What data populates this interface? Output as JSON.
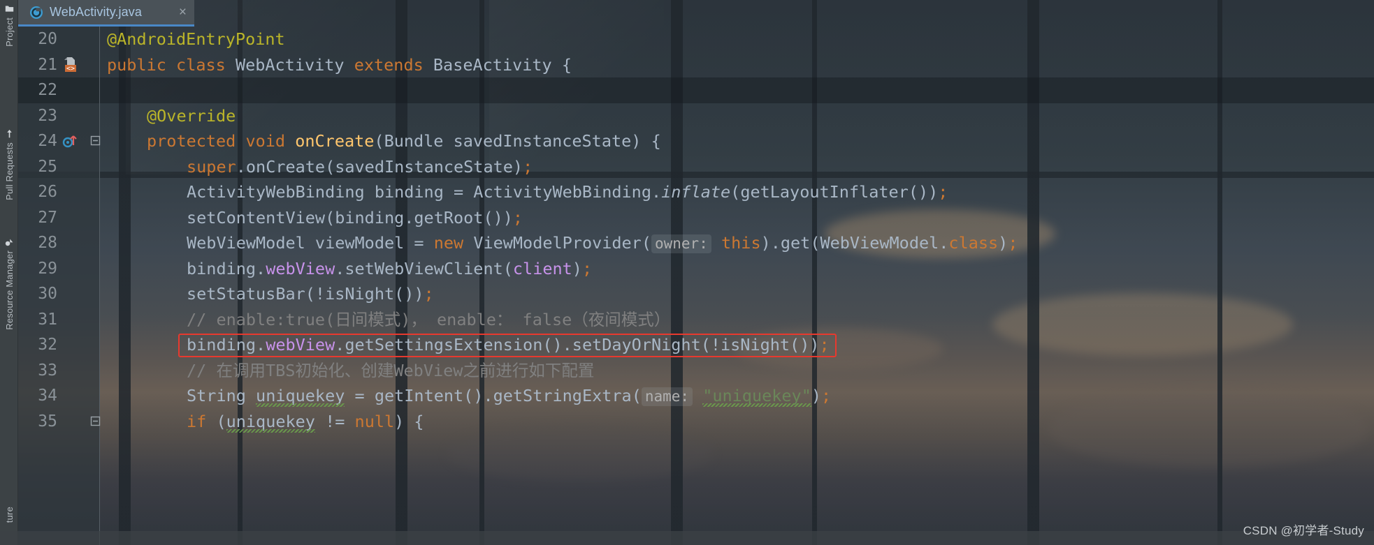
{
  "window": {
    "background_color": "#323a40",
    "accent_color": "#4a88c7",
    "highlight_box_color": "#e8392e"
  },
  "sidebar": {
    "items": [
      {
        "label": "Project",
        "icon": "folder-icon"
      },
      {
        "label": "Pull Requests",
        "icon": "pull-request-icon"
      },
      {
        "label": "Resource Manager",
        "icon": "resource-manager-icon"
      },
      {
        "label": "ture",
        "icon": "structure-icon"
      }
    ]
  },
  "tabs": [
    {
      "label": "WebActivity.java",
      "icon": "java-class-icon",
      "close_label": "×",
      "active": true
    }
  ],
  "editor": {
    "lines": [
      {
        "number": "20",
        "indent": 0,
        "gutter_icon": "",
        "fold_icon": "",
        "highlighted_band": false,
        "tokens": [
          {
            "t": "@AndroidEntryPoint",
            "c": "t-ann"
          }
        ]
      },
      {
        "number": "21",
        "indent": 0,
        "gutter_icon": "layout-xml-icon",
        "fold_icon": "",
        "highlighted_band": false,
        "tokens": [
          {
            "t": "public ",
            "c": "t-kw"
          },
          {
            "t": "class ",
            "c": "t-kw"
          },
          {
            "t": "WebActivity ",
            "c": "t-type"
          },
          {
            "t": "extends ",
            "c": "t-kw"
          },
          {
            "t": "BaseActivity {",
            "c": "t-type"
          }
        ]
      },
      {
        "number": "22",
        "indent": 0,
        "gutter_icon": "",
        "fold_icon": "",
        "highlighted_band": true,
        "tokens": []
      },
      {
        "number": "23",
        "indent": 1,
        "gutter_icon": "",
        "fold_icon": "",
        "highlighted_band": false,
        "tokens": [
          {
            "t": "@Override",
            "c": "t-ann"
          }
        ]
      },
      {
        "number": "24",
        "indent": 1,
        "gutter_icon": "override-method-icon",
        "fold_icon": "fold-collapse-icon",
        "highlighted_band": false,
        "tokens": [
          {
            "t": "protected ",
            "c": "t-kw"
          },
          {
            "t": "void ",
            "c": "t-kw"
          },
          {
            "t": "onCreate",
            "c": "t-meth"
          },
          {
            "t": "(Bundle savedInstanceState) {",
            "c": "t-plain"
          }
        ]
      },
      {
        "number": "25",
        "indent": 2,
        "gutter_icon": "",
        "fold_icon": "",
        "highlighted_band": false,
        "tokens": [
          {
            "t": "super",
            "c": "t-kw"
          },
          {
            "t": ".onCreate(savedInstanceState)",
            "c": "t-plain"
          },
          {
            "t": ";",
            "c": "t-semi"
          }
        ]
      },
      {
        "number": "26",
        "indent": 2,
        "gutter_icon": "",
        "fold_icon": "",
        "highlighted_band": false,
        "tokens": [
          {
            "t": "ActivityWebBinding binding = ActivityWebBinding.",
            "c": "t-plain"
          },
          {
            "t": "inflate",
            "c": "t-stat"
          },
          {
            "t": "(getLayoutInflater())",
            "c": "t-plain"
          },
          {
            "t": ";",
            "c": "t-semi"
          }
        ]
      },
      {
        "number": "27",
        "indent": 2,
        "gutter_icon": "",
        "fold_icon": "",
        "highlighted_band": false,
        "tokens": [
          {
            "t": "setContentView(binding.getRoot())",
            "c": "t-plain"
          },
          {
            "t": ";",
            "c": "t-semi"
          }
        ]
      },
      {
        "number": "28",
        "indent": 2,
        "gutter_icon": "",
        "fold_icon": "",
        "highlighted_band": false,
        "tokens": [
          {
            "t": "WebViewModel viewModel = ",
            "c": "t-plain"
          },
          {
            "t": "new ",
            "c": "t-kw"
          },
          {
            "t": "ViewModelProvider(",
            "c": "t-plain"
          },
          {
            "t": "owner:",
            "c": "t-param"
          },
          {
            "t": " ",
            "c": "t-plain"
          },
          {
            "t": "this",
            "c": "t-kw"
          },
          {
            "t": ").get(WebViewModel.",
            "c": "t-plain"
          },
          {
            "t": "class",
            "c": "t-kw"
          },
          {
            "t": ")",
            "c": "t-plain"
          },
          {
            "t": ";",
            "c": "t-semi"
          }
        ]
      },
      {
        "number": "29",
        "indent": 2,
        "gutter_icon": "",
        "fold_icon": "",
        "highlighted_band": false,
        "tokens": [
          {
            "t": "binding.",
            "c": "t-plain"
          },
          {
            "t": "webView",
            "c": "t-field"
          },
          {
            "t": ".setWebViewClient(",
            "c": "t-plain"
          },
          {
            "t": "client",
            "c": "t-field"
          },
          {
            "t": ")",
            "c": "t-plain"
          },
          {
            "t": ";",
            "c": "t-semi"
          }
        ]
      },
      {
        "number": "30",
        "indent": 2,
        "gutter_icon": "",
        "fold_icon": "",
        "highlighted_band": false,
        "tokens": [
          {
            "t": "setStatusBar(!isNight())",
            "c": "t-plain"
          },
          {
            "t": ";",
            "c": "t-semi"
          }
        ]
      },
      {
        "number": "31",
        "indent": 2,
        "gutter_icon": "",
        "fold_icon": "",
        "highlighted_band": false,
        "tokens": [
          {
            "t": "// enable:true(日间模式)， enable： false（夜间模式）",
            "c": "t-cmt"
          }
        ]
      },
      {
        "number": "32",
        "indent": 2,
        "gutter_icon": "",
        "fold_icon": "",
        "highlighted_band": false,
        "boxed": true,
        "tokens": [
          {
            "t": "binding.",
            "c": "t-plain"
          },
          {
            "t": "webView",
            "c": "t-field"
          },
          {
            "t": ".getSettingsExtension().setDayOrNight(!isNight())",
            "c": "t-plain"
          },
          {
            "t": ";",
            "c": "t-semi"
          }
        ]
      },
      {
        "number": "33",
        "indent": 2,
        "gutter_icon": "",
        "fold_icon": "",
        "highlighted_band": false,
        "tokens": [
          {
            "t": "// 在调用TBS初始化、创建WebView之前进行如下配置",
            "c": "t-cmt"
          }
        ]
      },
      {
        "number": "34",
        "indent": 2,
        "gutter_icon": "",
        "fold_icon": "",
        "highlighted_band": false,
        "tokens": [
          {
            "t": "String ",
            "c": "t-plain"
          },
          {
            "t": "uniquekey",
            "c": "t-plain typo"
          },
          {
            "t": " = getIntent().getStringExtra(",
            "c": "t-plain"
          },
          {
            "t": "name:",
            "c": "t-param"
          },
          {
            "t": " ",
            "c": "t-plain"
          },
          {
            "t": "\"uniquekey\"",
            "c": "t-str typo"
          },
          {
            "t": ")",
            "c": "t-plain"
          },
          {
            "t": ";",
            "c": "t-semi"
          }
        ]
      },
      {
        "number": "35",
        "indent": 2,
        "gutter_icon": "",
        "fold_icon": "fold-collapse-icon",
        "highlighted_band": false,
        "tokens": [
          {
            "t": "if ",
            "c": "t-kw"
          },
          {
            "t": "(",
            "c": "t-plain"
          },
          {
            "t": "uniquekey",
            "c": "t-plain typo"
          },
          {
            "t": " != ",
            "c": "t-plain"
          },
          {
            "t": "null",
            "c": "t-kw"
          },
          {
            "t": ") {",
            "c": "t-plain"
          }
        ]
      }
    ]
  },
  "watermark": {
    "text": "CSDN @初学者-Study"
  }
}
